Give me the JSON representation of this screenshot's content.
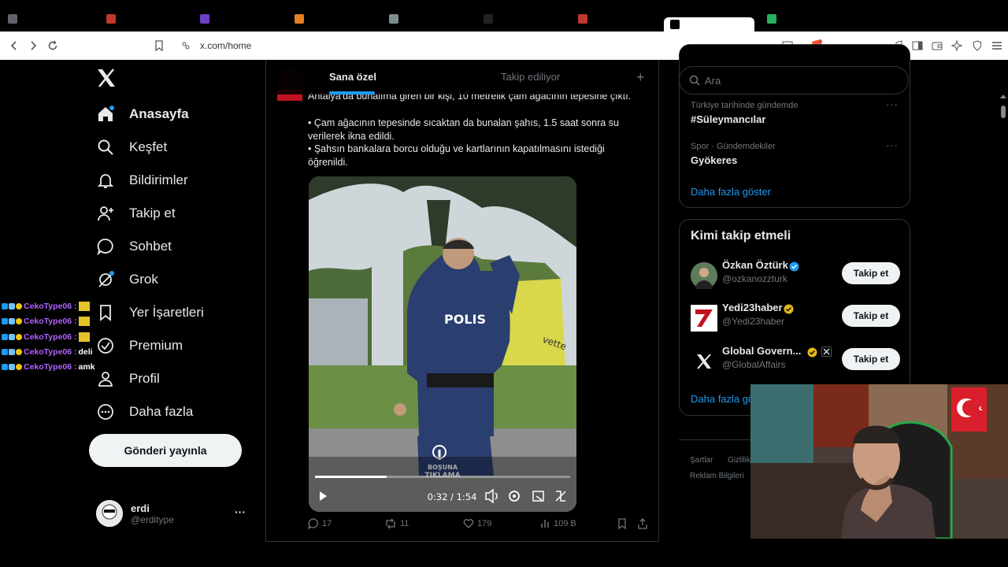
{
  "browser": {
    "tabs": [
      "",
      "",
      "",
      "",
      "",
      "",
      "",
      "",
      ""
    ],
    "url": "x.com/home"
  },
  "nav": {
    "items": [
      {
        "label": "Anasayfa",
        "icon": "home-icon"
      },
      {
        "label": "Keşfet",
        "icon": "search-icon"
      },
      {
        "label": "Bildirimler",
        "icon": "bell-icon"
      },
      {
        "label": "Takip et",
        "icon": "add-user-icon"
      },
      {
        "label": "Sohbet",
        "icon": "chat-icon"
      },
      {
        "label": "Grok",
        "icon": "grok-icon"
      },
      {
        "label": "Yer İşaretleri",
        "icon": "bookmark-icon"
      },
      {
        "label": "Premium",
        "icon": "premium-icon"
      },
      {
        "label": "Profil",
        "icon": "profile-icon"
      },
      {
        "label": "Daha fazla",
        "icon": "more-circle-icon"
      }
    ],
    "post_label": "Gönderi yayınla",
    "profile": {
      "name": "erdi",
      "handle": "@erditype",
      "more": "···"
    }
  },
  "main": {
    "tabs": [
      {
        "label": "Sana özel"
      },
      {
        "label": "Takip ediliyor"
      }
    ],
    "add_tab": "+",
    "tweet": {
      "line1": "Antalya'da bunalıma giren bir kişi, 10 metrelik çam ağacının tepesine çıktı.",
      "bullet1": "• Çam ağacının tepesinde sıcaktan da bunalan şahıs, 1.5 saat sonra su verilerek ikna edildi.",
      "bullet2": "• Şahsın bankalara borcu olduğu ve kartlarının kapatılmasını istediği öğrenildi.",
      "video": {
        "overlay_police": "POLIS",
        "overlay_brand": "vette",
        "watermark_top": "BOŞUNA",
        "watermark_bottom": "TIKLAMA",
        "time": "0:32 / 1:54",
        "progress": 0.28
      },
      "actions": {
        "replies": "17",
        "reposts": "11",
        "likes": "179",
        "views": "109 B"
      }
    }
  },
  "right": {
    "search_placeholder": "Ara",
    "trends": [
      {
        "category": "Türkiye tarihinde gündemde",
        "name": "#Süleymancılar"
      },
      {
        "category": "Spor · Gündemdekiler",
        "name": "Gyökeres"
      }
    ],
    "show_more": "Daha fazla göster",
    "who_to_follow": {
      "title": "Kimi takip etmeli",
      "accounts": [
        {
          "name": "Özkan Öztürk",
          "handle": "@ozkanozzturk",
          "button": "Takip et"
        },
        {
          "name": "Yedi23haber",
          "handle": "@Yedi23haber",
          "button": "Takip et"
        },
        {
          "name": "Global Govern...",
          "handle": "@GlobalAffairs",
          "button": "Takip et"
        }
      ],
      "show_more": "Daha fazla göster"
    },
    "footer": {
      "terms": "Şartlar",
      "privacy": "Gizlilik",
      "ads": "Reklam Bilgileri"
    }
  },
  "chat_overlay": [
    {
      "user": "CekoType06 :",
      "msg": ""
    },
    {
      "user": "CekoType06 :",
      "msg": ""
    },
    {
      "user": "CekoType06 :",
      "msg": ""
    },
    {
      "user": "CekoType06 :",
      "msg": "deli"
    },
    {
      "user": "CekoType06 :",
      "msg": "amk"
    }
  ],
  "colors": {
    "accent": "#1d9bf0",
    "background": "#000000",
    "chat_user": "#b061ff",
    "verified": "#1d9bf0",
    "gold_verified": "#e2b719"
  }
}
